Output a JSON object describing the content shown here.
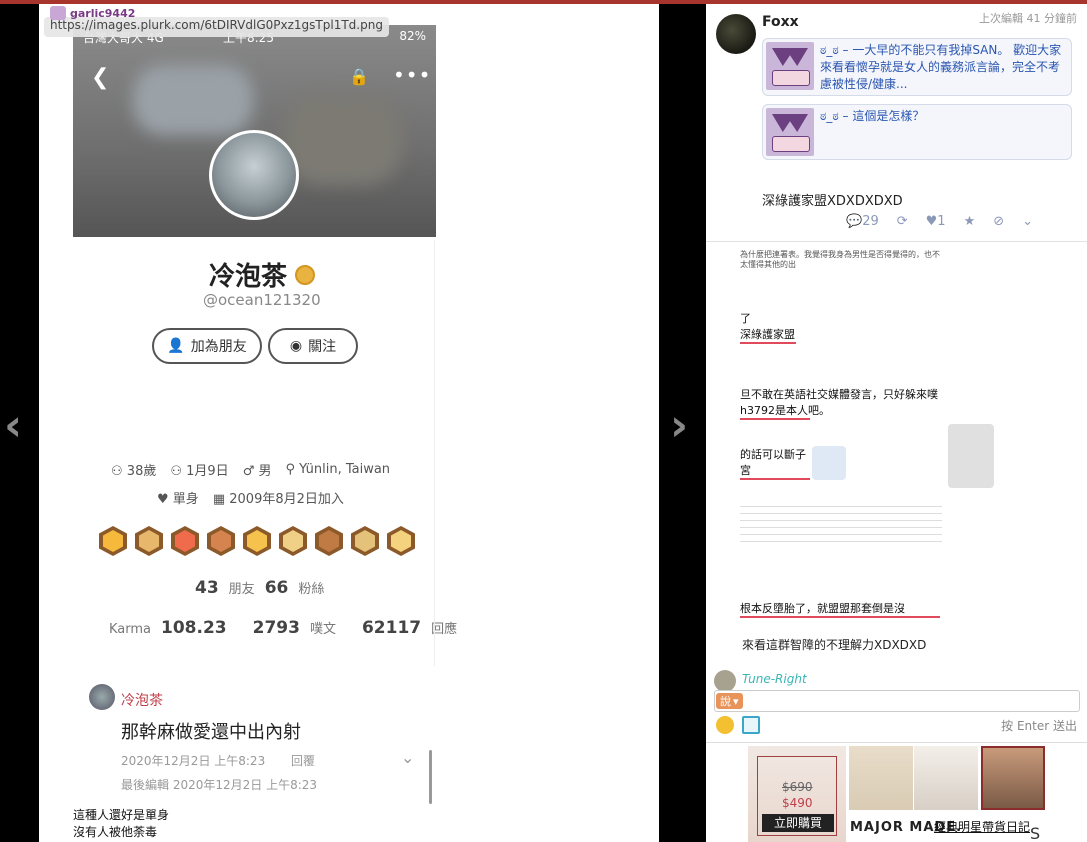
{
  "viewer": {
    "username": "garlic9442",
    "url": "https://images.plurk.com/6tDIRVdlG0Pxz1gsTpl1Td.png",
    "phone_status": {
      "carrier": "台灣大哥大",
      "network": "4G",
      "time": "上午8:25",
      "battery": "82%"
    },
    "profile": {
      "name": "冷泡茶",
      "handle": "@ocean121320",
      "add_friend_label": "加為朋友",
      "follow_label": "關注",
      "age": "38歲",
      "birthday": "1月9日",
      "gender": "男",
      "location": "Yünlin, Taiwan",
      "relationship": "單身",
      "joined": "2009年8月2日加入",
      "friends_count": "43",
      "friends_label": "朋友",
      "fans_count": "66",
      "fans_label": "粉絲",
      "karma_label": "Karma",
      "karma": "108.23",
      "plurks_count": "2793",
      "plurks_label": "噗文",
      "replies_count": "62117",
      "replies_label": "回應"
    },
    "comment": {
      "author": "冷泡茶",
      "text": "那幹麻做愛還中出內射",
      "timestamp": "2020年12月2日 上午8:23",
      "reply_label": "回覆",
      "last_edit": "最後編輯 2020年12月2日 上午8:23"
    },
    "bottom_lines": [
      "這種人還好是單身",
      "沒有人被他荼毒"
    ]
  },
  "panel": {
    "author": "Foxx",
    "edit_time": "上次編輯 41 分鐘前",
    "links": [
      {
        "text": "ಠ_ಠ – 一大早的不能只有我掉SAN。 歡迎大家來看看懷孕就是女人的義務派言論，完全不考慮被性侵/健康..."
      },
      {
        "text": "ಠ_ಠ – 這個是怎樣？"
      }
    ],
    "post_text": "深綠護家盟XDXDXDXD",
    "actions": {
      "comments_count": "29",
      "likes_count": "1"
    },
    "scraps": [
      "為什麼把連署表。我覺得我身為男性是否得覺得的，也不太懂得其他的出",
      "了",
      "深綠護家盟",
      "旦不敢在英語社交媒體發言，只好躲來噗浪跟",
      "h3792是本人吧。",
      "的話可以斷子宮",
      "根本反墮胎了，就盟盟那套倒是沒",
      "來看這群智障的不理解力XDXDXD"
    ],
    "reply_nick": "Tune-Right",
    "say_label": "說",
    "enter_hint": "按 Enter 送出",
    "ad": {
      "price_old": "$690",
      "price_new": "$490",
      "buy_label": "立即購買",
      "brand": "MAJOR MADE.",
      "link": "經典明星帶貨日記",
      "trail": "S"
    }
  }
}
